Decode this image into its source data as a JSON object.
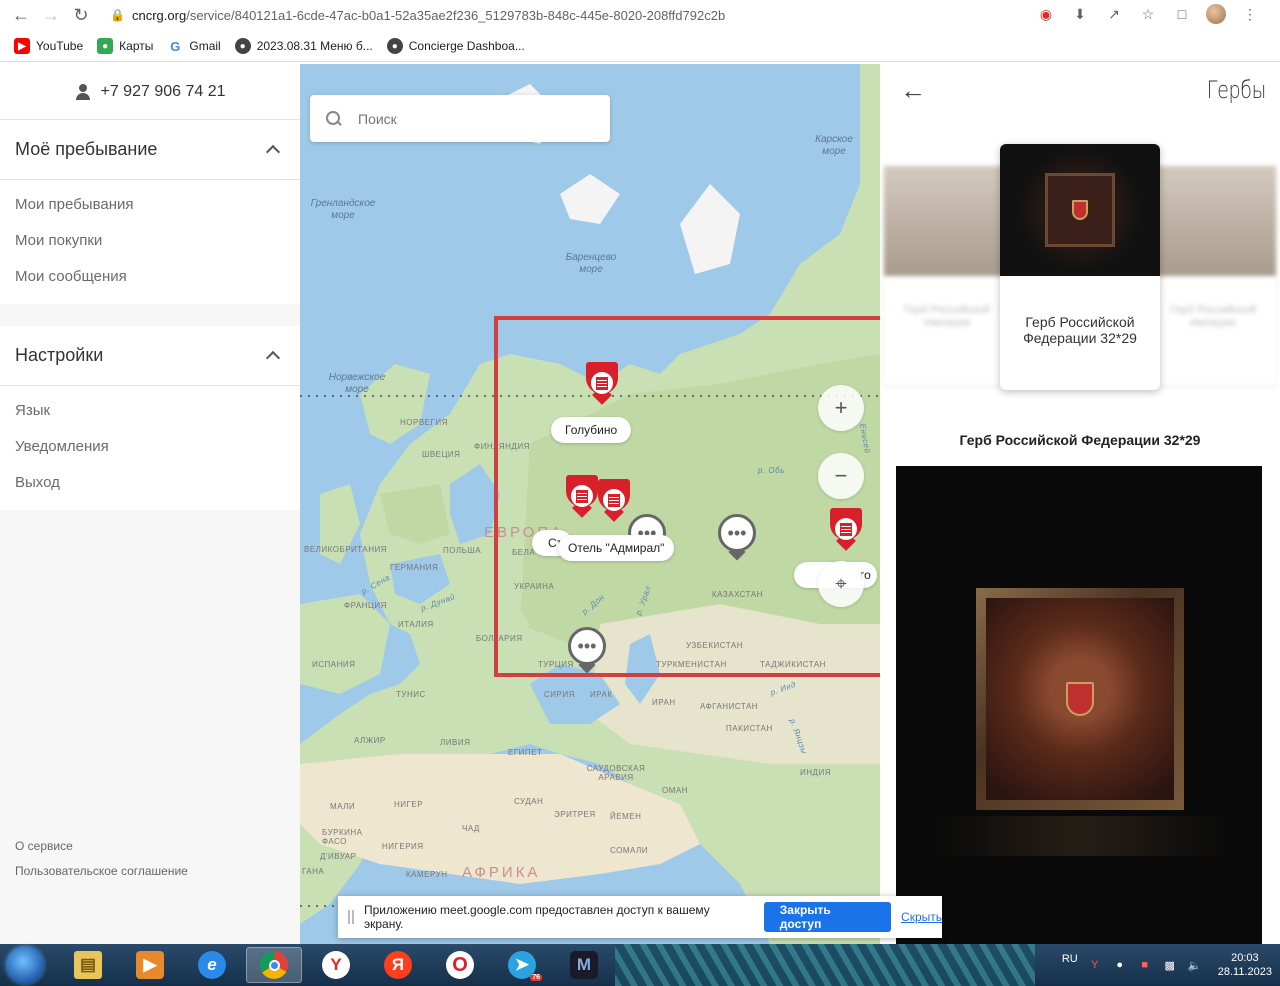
{
  "browser": {
    "url_host": "cncrg.org",
    "url_path": "/service/840121a1-6cde-47ac-b0a1-52a35ae2f236_5129783b-848c-445e-8020-208ffd792c2b",
    "bookmarks": [
      {
        "label": "YouTube",
        "icon": "youtube-icon",
        "color": "#ff0000"
      },
      {
        "label": "Карты",
        "icon": "maps-icon",
        "color": "#34a853"
      },
      {
        "label": "Gmail",
        "icon": "google-icon",
        "color": "#4285f4"
      },
      {
        "label": "2023.08.31 Меню б...",
        "icon": "globe-icon",
        "color": "#333333"
      },
      {
        "label": "Concierge Dashboa...",
        "icon": "globe-icon",
        "color": "#333333"
      }
    ]
  },
  "sidebar": {
    "phone": "+7 927 906 74 21",
    "stay_section": {
      "title": "Моё пребывание",
      "items": [
        "Мои пребывания",
        "Мои покупки",
        "Мои сообщения"
      ]
    },
    "settings_section": {
      "title": "Настройки",
      "items": [
        "Язык",
        "Уведомления",
        "Выход"
      ]
    },
    "footer": {
      "about": "О сервисе",
      "agreement": "Пользовательское соглашение"
    }
  },
  "map": {
    "search_placeholder": "Поиск",
    "zoom_in": "+",
    "zoom_out": "−",
    "sea_labels": {
      "kara": "Карское море",
      "greenland": "Гренландское море",
      "barents": "Баренцево море",
      "norwegian": "Норвежское море"
    },
    "regions": {
      "europe": "ЕВРОПА",
      "africa": "АФРИКА"
    },
    "countries": [
      "НОРВЕГИЯ",
      "ФИНЛЯНДИЯ",
      "ШВЕЦИЯ",
      "ВЕЛИКОБРИТАНИЯ",
      "ГЕРМАНИЯ",
      "ПОЛЬША",
      "БЕЛА",
      "ФРАНЦИЯ",
      "ИТАЛИЯ",
      "ИСПАНИЯ",
      "УКРАИНА",
      "БОЛГАРИЯ",
      "ТУРЦИЯ",
      "КАЗАХСТАН",
      "УЗБЕКИСТАН",
      "ТУРКМЕНИСТАН",
      "ТАДЖИКИСТАН",
      "СИРИЯ",
      "ИРАК",
      "ИРАН",
      "АФГАНИСТАН",
      "ПАКИСТАН",
      "ИНДИЯ",
      "ТУНИС",
      "АЛЖИР",
      "ЛИВИЯ",
      "ЕГИПЕТ",
      "САУДОВСКАЯ АРАВИЯ",
      "ОМАН",
      "СУДАН",
      "ЭРИТРЕЯ",
      "ЙЕМЕН",
      "СОМАЛИ",
      "ЧАД",
      "НИГЕР",
      "МАЛИ",
      "НИГЕРИЯ",
      "КАМЕРУН",
      "БУРКИНА ФАСО",
      "Д'ИВУАР",
      "ГАНА"
    ],
    "rivers": [
      "р. Обь",
      "р. Дон",
      "р. Урал",
      "р. Дунай",
      "р. Сена",
      "р. Инд",
      "р. Янцзы",
      "Енисей"
    ],
    "place_tags": {
      "golubino": "Голубино",
      "admiral": "Отель \"Адмирал\"",
      "st_partial": "Ст",
      "right_partial": "го"
    }
  },
  "panel": {
    "title": "Гербы",
    "carousel": {
      "left_card": "Герб Российской Империи",
      "main_card": "Герб Российской Федерации 32*29",
      "right_card": "Герб Российской Империи"
    },
    "product_title": "Герб Российской Федерации 32*29"
  },
  "share_bar": {
    "message": "Приложению meet.google.com предоставлен доступ к вашему экрану.",
    "stop_label": "Закрыть доступ",
    "hide_label": "Скрыть"
  },
  "taskbar": {
    "lang": "RU",
    "time": "20:03",
    "date": "28.11.2023",
    "telegram_badge": "76"
  }
}
